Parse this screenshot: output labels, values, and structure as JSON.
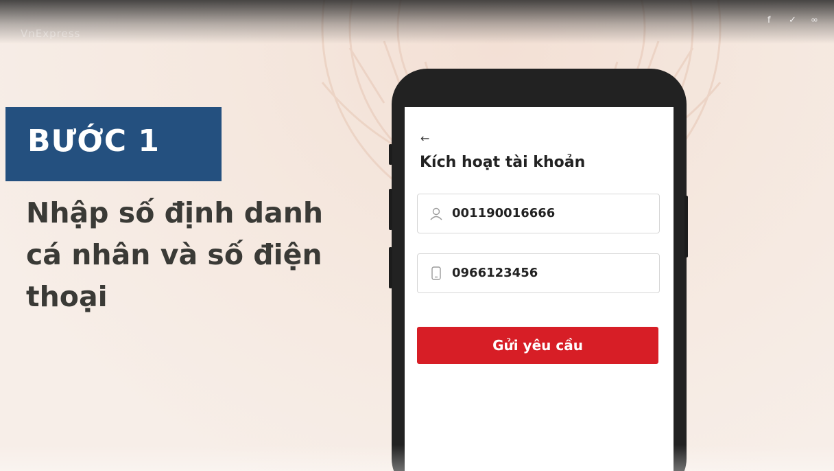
{
  "header": {
    "brand": "VnExpress",
    "social_icons": [
      "facebook-icon",
      "twitter-icon",
      "link-icon"
    ],
    "facebook_glyph": "f",
    "twitter_glyph": "✓",
    "link_glyph": "∞"
  },
  "step": {
    "label": "BƯỚC 1",
    "description_lines": [
      "Nhập số định danh",
      "cá nhân và số điện",
      "thoại"
    ]
  },
  "phone_screen": {
    "back_glyph": "←",
    "title": "Kích hoạt tài khoản",
    "id_field": {
      "icon": "user-icon",
      "value": "001190016666"
    },
    "phone_field": {
      "icon": "mobile-phone-icon",
      "value": "0966123456"
    },
    "submit_label": "Gửi yêu cầu"
  },
  "colors": {
    "step_box": "#24507f",
    "submit_button": "#d71e26",
    "heading_text": "#3a3a36",
    "background": "#f6ebe3"
  }
}
